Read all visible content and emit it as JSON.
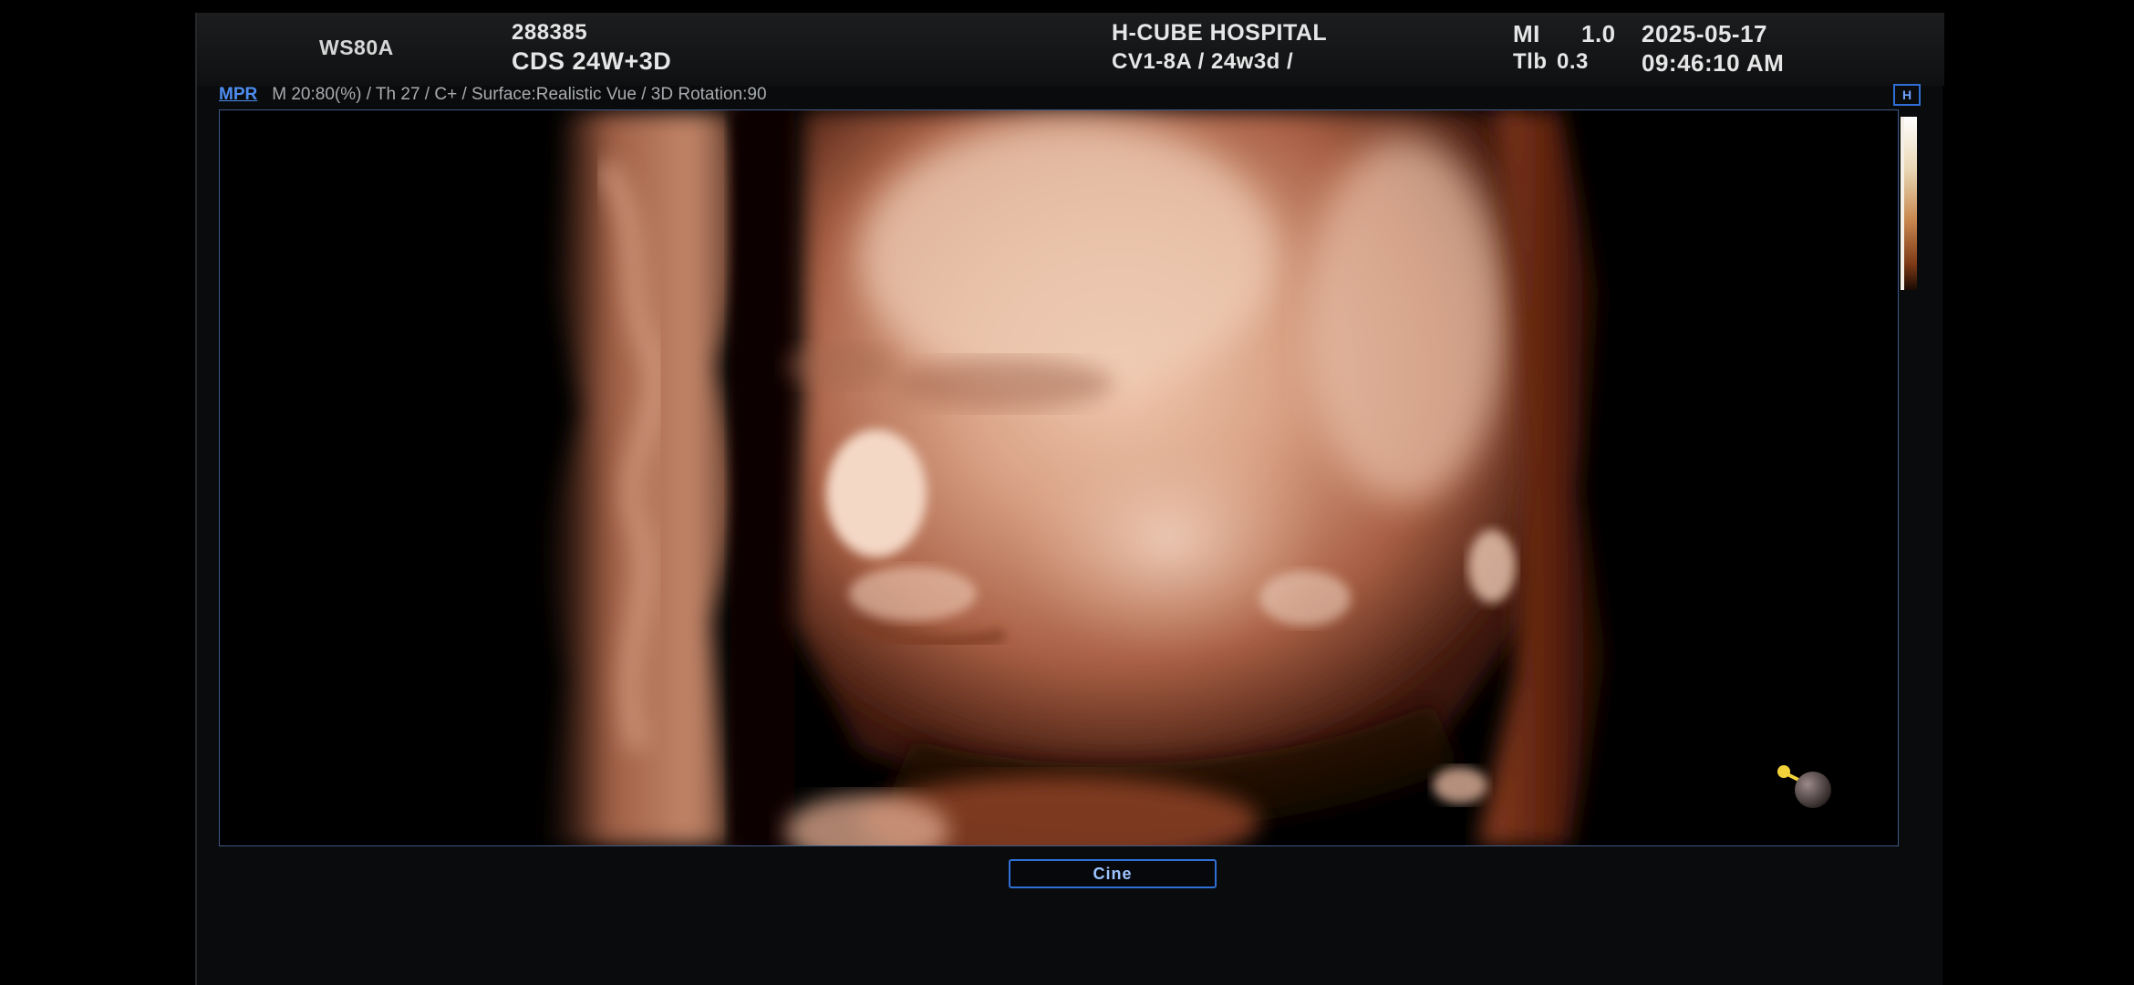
{
  "header": {
    "model": "WS80A",
    "patient_id": "288385",
    "patient_name": "CDS 24W+3D",
    "hospital": "H-CUBE HOSPITAL",
    "probe_preset": "CV1-8A / 24w3d /",
    "mi_label": "MI",
    "mi_value": "1.0",
    "tib_label": "Tlb",
    "tib_value": "0.3",
    "date": "2025-05-17",
    "time": "09:46:10 AM"
  },
  "info_bar": {
    "mode_tab": "MPR",
    "params": "M 20:80(%) / Th 27 / C+ / Surface:Realistic Vue / 3D Rotation:90"
  },
  "badge": {
    "label": "H"
  },
  "buttons": {
    "cine": "Cine"
  },
  "colors": {
    "accent": "#2f6fd6",
    "skin": "#c98a6a",
    "background": "#0a0b0c"
  }
}
